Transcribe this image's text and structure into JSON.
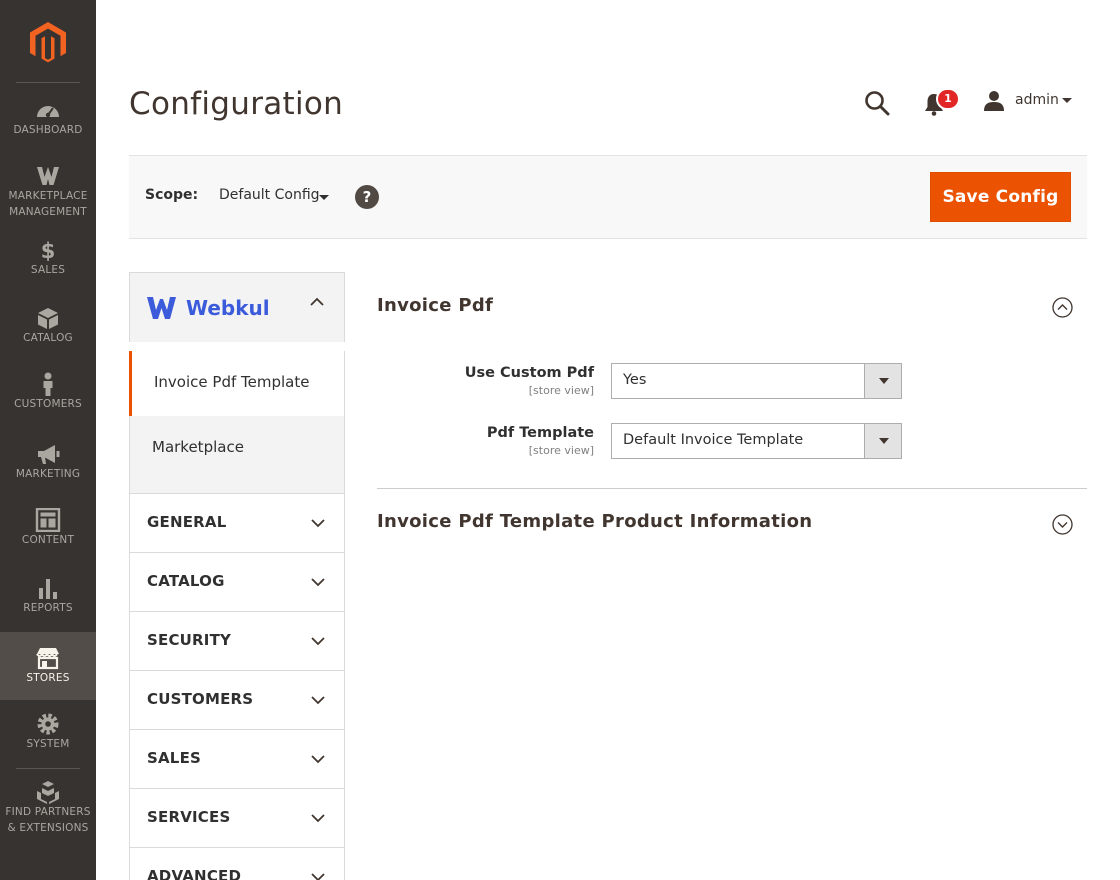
{
  "nav": {
    "items": [
      {
        "label": "DASHBOARD",
        "icon": "dashboard-icon"
      },
      {
        "label": "MARKETPLACE\nMANAGEMENT",
        "icon": "marketplace-icon"
      },
      {
        "label": "SALES",
        "icon": "dollar-icon"
      },
      {
        "label": "CATALOG",
        "icon": "box-icon"
      },
      {
        "label": "CUSTOMERS",
        "icon": "person-icon"
      },
      {
        "label": "MARKETING",
        "icon": "megaphone-icon"
      },
      {
        "label": "CONTENT",
        "icon": "content-layout-icon"
      },
      {
        "label": "REPORTS",
        "icon": "bar-chart-icon"
      },
      {
        "label": "STORES",
        "icon": "storefront-icon"
      },
      {
        "label": "SYSTEM",
        "icon": "gear-icon"
      },
      {
        "label": "FIND PARTNERS\n& EXTENSIONS",
        "icon": "cubes-icon"
      }
    ],
    "active": "STORES"
  },
  "header": {
    "title": "Configuration",
    "notifications_count": "1",
    "user": "admin"
  },
  "scope": {
    "label": "Scope:",
    "value": "Default Config",
    "help": "?",
    "save_label": "Save Config"
  },
  "sidebar": {
    "vendor": "Webkul",
    "sub_items": [
      "Invoice Pdf Template",
      "Marketplace"
    ],
    "sections": [
      "GENERAL",
      "CATALOG",
      "SECURITY",
      "CUSTOMERS",
      "SALES",
      "SERVICES",
      "ADVANCED"
    ]
  },
  "main": {
    "section1": {
      "title": "Invoice Pdf",
      "fields": [
        {
          "label": "Use Custom Pdf",
          "scope": "[store view]",
          "value": "Yes"
        },
        {
          "label": "Pdf Template",
          "scope": "[store view]",
          "value": "Default Invoice Template"
        }
      ]
    },
    "section2": {
      "title": "Invoice Pdf Template Product Information"
    }
  },
  "colors": {
    "accent": "#eb5202",
    "nav_bg": "#373330",
    "nav_active": "#524d49",
    "badge": "#e22626",
    "webkul_blue": "#3b5bdb"
  }
}
